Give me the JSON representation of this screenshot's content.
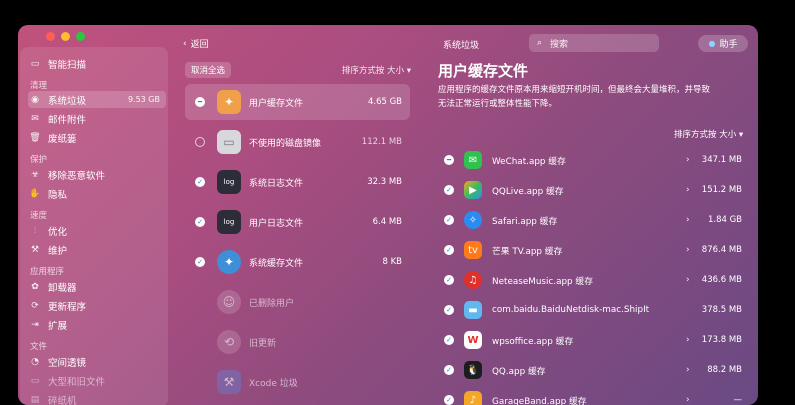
{
  "topbar": {
    "back": "返回",
    "title": "系统垃圾",
    "search_placeholder": "搜索",
    "help": "助手"
  },
  "colors": {
    "close": "#ff5f57",
    "minimize": "#febc2e",
    "zoom": "#28c840",
    "check_accent": "#3a78d6"
  },
  "sidebar": {
    "smart": "智能扫描",
    "sec_clean": "清理",
    "syslitter": "系统垃圾",
    "syslitter_size": "9.53 GB",
    "mail": "邮件附件",
    "trash": "废纸篓",
    "sec_protect": "保护",
    "malware": "移除恶意软件",
    "privacy": "隐私",
    "sec_speed": "速度",
    "optimize": "优化",
    "maintain": "维护",
    "sec_apps": "应用程序",
    "uninstall": "卸载器",
    "updater": "更新程序",
    "extensions": "扩展",
    "sec_files": "文件",
    "space": "空间透镜",
    "large": "大型和旧文件",
    "shredder": "碎纸机"
  },
  "middle": {
    "deselect": "取消全选",
    "sort": "排序方式按 大小 ▾",
    "items": [
      {
        "label": "用户缓存文件",
        "size": "4.65 GB",
        "check": "part"
      },
      {
        "label": "不使用的磁盘镜像",
        "size": "112.1 MB",
        "check": "off"
      },
      {
        "label": "系统日志文件",
        "size": "32.3 MB",
        "check": "on"
      },
      {
        "label": "用户日志文件",
        "size": "6.4 MB",
        "check": "on"
      },
      {
        "label": "系统缓存文件",
        "size": "8 KB",
        "check": "on"
      },
      {
        "label": "已删除用户",
        "size": "",
        "check": "none"
      },
      {
        "label": "旧更新",
        "size": "",
        "check": "none"
      },
      {
        "label": "Xcode 垃圾",
        "size": "",
        "check": "none"
      }
    ]
  },
  "right": {
    "title": "用户缓存文件",
    "desc1": "应用程序的缓存文件原本用来缩短开机时间，但最终会大量堆积，并导致",
    "desc2": "无法正常运行或整体性能下降。",
    "sort": "排序方式按 大小 ▾",
    "rows": [
      {
        "label": "WeChat.app 缓存",
        "size": "347.1 MB"
      },
      {
        "label": "QQLive.app 缓存",
        "size": "151.2 MB"
      },
      {
        "label": "Safari.app 缓存",
        "size": "1.84 GB"
      },
      {
        "label": "芒果 TV.app 缓存",
        "size": "876.4 MB"
      },
      {
        "label": "NeteaseMusic.app 缓存",
        "size": "436.6 MB"
      },
      {
        "label": "com.baidu.BaiduNetdisk-mac.ShipIt",
        "size": "378.5 MB"
      },
      {
        "label": "wpsoffice.app 缓存",
        "size": "173.8 MB"
      },
      {
        "label": "QQ.app 缓存",
        "size": "88.2 MB"
      },
      {
        "label": "GarageBand.app 缓存",
        "size": "—"
      }
    ]
  }
}
